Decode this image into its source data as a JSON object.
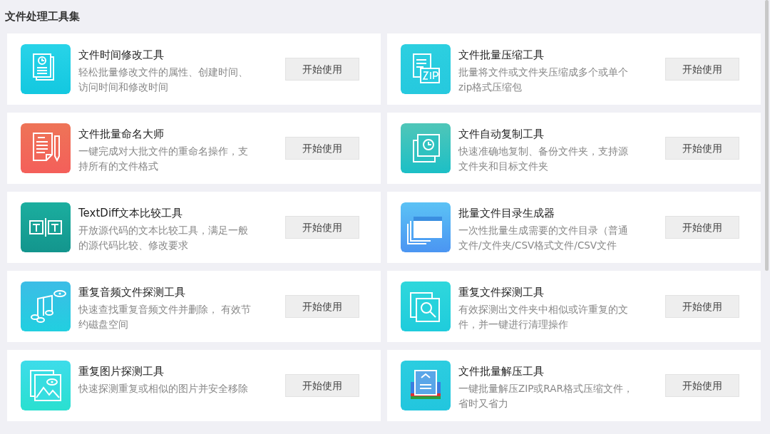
{
  "heading": "文件处理工具集",
  "tools": [
    {
      "kind": "time",
      "title": "文件时间修改工具",
      "description_lines": [
        "轻松批量修改文件的属性、创建时间、",
        "访问时间和修改时间"
      ],
      "button": "开始使用"
    },
    {
      "kind": "zip",
      "title": "文件批量压缩工具",
      "description_lines": [
        "批量将文件或文件夹压缩成多个或单个",
        "zip格式压缩包"
      ],
      "button": "开始使用"
    },
    {
      "kind": "rename",
      "title": "文件批量命名大师",
      "description_lines": [
        "一键完成对大批文件的重命名操作，支",
        "持所有的文件格式"
      ],
      "button": "开始使用"
    },
    {
      "kind": "copy",
      "title": "文件自动复制工具",
      "description_lines": [
        "快速准确地复制、备份文件夹，支持源",
        "文件夹和目标文件夹"
      ],
      "button": "开始使用"
    },
    {
      "kind": "diff",
      "title": "TextDiff文本比较工具",
      "description_lines": [
        "开放源代码的文本比较工具，满足一般",
        "的源代码比较、修改要求"
      ],
      "button": "开始使用"
    },
    {
      "kind": "folder",
      "title": "批量文件目录生成器",
      "description_lines": [
        "一次性批量生成需要的文件目录（普通",
        "文件/文件夹/CSV格式文件/CSV文件"
      ],
      "button": "开始使用"
    },
    {
      "kind": "music",
      "title": "重复音频文件探测工具",
      "description_lines": [
        "快速查找重复音频文件并删除， 有效节",
        "约磁盘空间"
      ],
      "button": "开始使用"
    },
    {
      "kind": "search",
      "title": "重复文件探测工具",
      "description_lines": [
        "有效探测出文件夹中相似或许重复的文",
        "件，并一键进行清理操作"
      ],
      "button": "开始使用"
    },
    {
      "kind": "image",
      "title": "重复图片探测工具",
      "description_lines": [
        "快速探测重复或相似的图片并安全移除"
      ],
      "button": "开始使用"
    },
    {
      "kind": "unzip",
      "title": "文件批量解压工具",
      "description_lines": [
        "一键批量解压ZIP或RAR格式压缩文件，",
        "省时又省力"
      ],
      "button": "开始使用"
    }
  ]
}
